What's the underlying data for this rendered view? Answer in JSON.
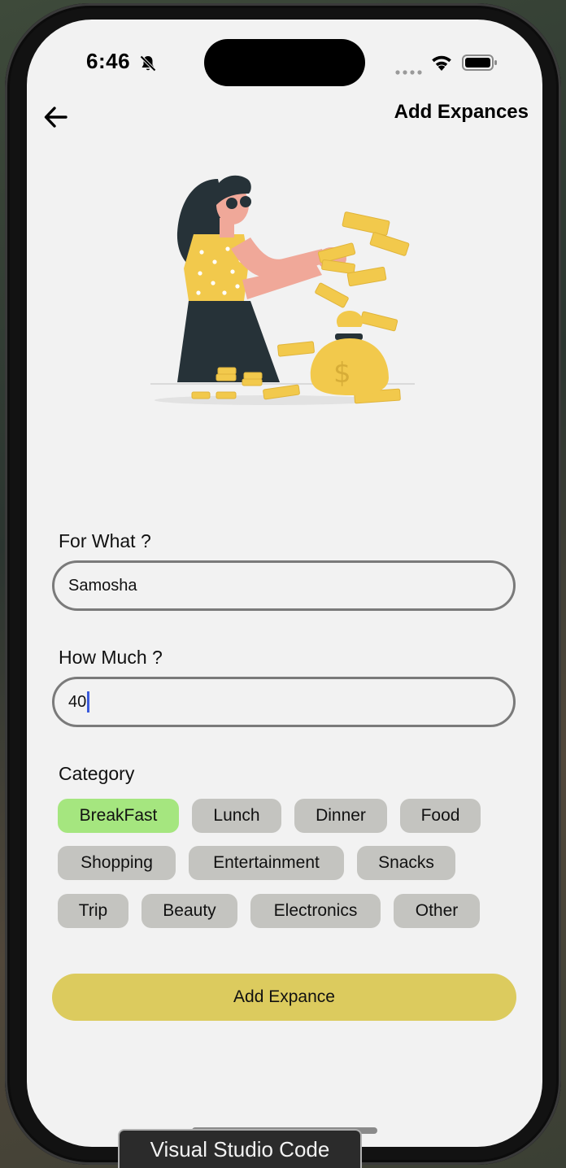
{
  "status_bar": {
    "time": "6:46",
    "icons": [
      "bell-slash-icon",
      "signal-icon",
      "wifi-icon",
      "battery-icon"
    ]
  },
  "header": {
    "back_icon": "arrow-left-icon",
    "title": "Add Expances"
  },
  "illustration": {
    "icon": "woman-throwing-money-illustration",
    "bag_symbol": "$"
  },
  "form": {
    "for_what": {
      "label": "For What ?",
      "value": "Samosha"
    },
    "how_much": {
      "label": "How Much ?",
      "value": "40"
    },
    "category": {
      "label": "Category",
      "selected": "BreakFast",
      "options": [
        "BreakFast",
        "Lunch",
        "Dinner",
        "Food",
        "Shopping",
        "Entertainment",
        "Snacks",
        "Trip",
        "Beauty",
        "Electronics",
        "Other"
      ]
    }
  },
  "submit_button": {
    "label": "Add Expance"
  },
  "tooltip": {
    "text": "Visual Studio Code"
  },
  "colors": {
    "screen_background": "#f2f2f2",
    "chip_default": "#c4c4c0",
    "chip_selected": "#a5e67f",
    "submit_button": "#dccb5e",
    "illustration_accent": "#f2c94c",
    "caret": "#3b5bdb"
  }
}
